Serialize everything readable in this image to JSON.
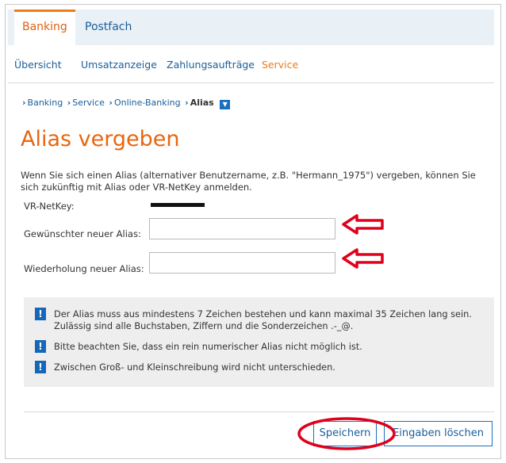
{
  "top_tabs": [
    {
      "label": "Banking",
      "active": true
    },
    {
      "label": "Postfach",
      "active": false
    }
  ],
  "subnav": [
    {
      "label": "Übersicht",
      "active": false
    },
    {
      "label": "Umsatzanzeige",
      "active": false
    },
    {
      "label": "Zahlungsaufträge",
      "active": false
    },
    {
      "label": "Service",
      "active": true
    }
  ],
  "breadcrumb": [
    "Banking",
    "Service",
    "Online-Banking",
    "Alias"
  ],
  "page_title": "Alias vergeben",
  "intro": "Wenn Sie sich einen Alias (alternativer Benutzername, z.B. \"Hermann_1975\") vergeben, können Sie sich zukünftig mit Alias oder VR-NetKey anmelden.",
  "form": {
    "netkey_label": "VR-NetKey:",
    "new_alias_label": "Gewünschter neuer Alias:",
    "new_alias_value": "",
    "repeat_alias_label": "Wiederholung neuer Alias:",
    "repeat_alias_value": ""
  },
  "info": [
    "Der Alias muss aus mindestens 7 Zeichen bestehen und kann maximal 35 Zeichen lang sein. Zulässig sind alle Buchstaben, Ziffern und die Sonderzeichen .-_@.",
    "Bitte beachten Sie, dass ein rein numerischer Alias nicht möglich ist.",
    "Zwischen Groß- und Kleinschreibung wird nicht unterschieden."
  ],
  "buttons": {
    "save": "Speichern",
    "clear": "Eingaben löschen"
  },
  "colors": {
    "accent_orange": "#e8660f",
    "link_blue": "#1a5e9a",
    "annotation_red": "#e0001b",
    "info_icon_blue": "#1667b7"
  },
  "icons": {
    "info": "exclamation-mark",
    "annotation": "red-outline-arrow-left"
  }
}
